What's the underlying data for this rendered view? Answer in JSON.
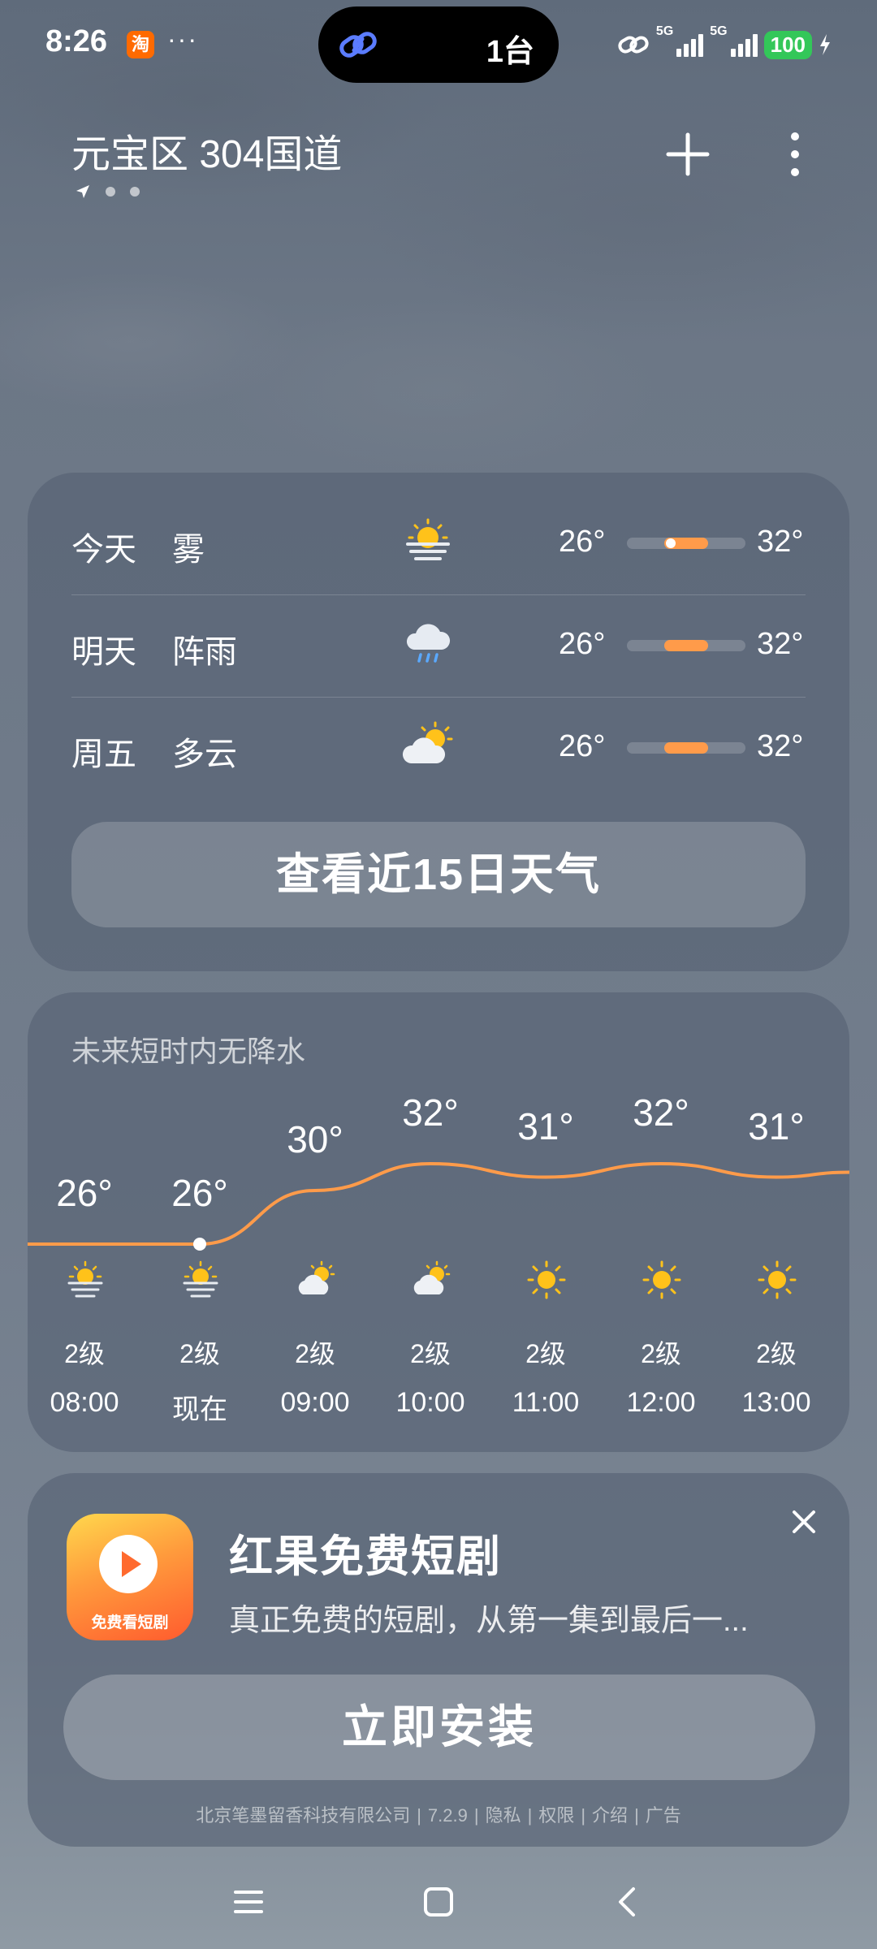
{
  "status_bar": {
    "time": "8:26",
    "app_badge": "淘",
    "more": "···",
    "island_count": "1台",
    "network_1": "5G",
    "network_2": "5G",
    "battery": "100"
  },
  "header": {
    "location": "元宝区 304国道",
    "icons": [
      "location-arrow-icon",
      "plus-icon",
      "more-vertical-icon"
    ]
  },
  "daily": [
    {
      "day": "今天",
      "condition": "雾",
      "icon": "fog-icon",
      "low": "26°",
      "high": "32°",
      "current_marker": true
    },
    {
      "day": "明天",
      "condition": "阵雨",
      "icon": "shower-icon",
      "low": "26°",
      "high": "32°",
      "current_marker": false
    },
    {
      "day": "周五",
      "condition": "多云",
      "icon": "partly-cloudy-icon",
      "low": "26°",
      "high": "32°",
      "current_marker": false
    }
  ],
  "daily_button": "查看近15日天气",
  "hourly": {
    "note": "未来短时内无降水",
    "items": [
      {
        "temp": "26°",
        "value": 26,
        "icon": "fog-icon",
        "wind": "2级",
        "time": "08:00"
      },
      {
        "temp": "26°",
        "value": 26,
        "icon": "fog-icon",
        "wind": "2级",
        "time": "现在"
      },
      {
        "temp": "30°",
        "value": 30,
        "icon": "partly-cloudy-icon",
        "wind": "2级",
        "time": "09:00"
      },
      {
        "temp": "32°",
        "value": 32,
        "icon": "partly-cloudy-icon",
        "wind": "2级",
        "time": "10:00"
      },
      {
        "temp": "31°",
        "value": 31,
        "icon": "sun-icon",
        "wind": "2级",
        "time": "11:00"
      },
      {
        "temp": "32°",
        "value": 32,
        "icon": "sun-icon",
        "wind": "2级",
        "time": "12:00"
      },
      {
        "temp": "31°",
        "value": 31,
        "icon": "sun-icon",
        "wind": "2级",
        "time": "13:00"
      }
    ]
  },
  "ad": {
    "icon_label": "免费看短剧",
    "title": "红果免费短剧",
    "description": "真正免费的短剧，从第一集到最后一...",
    "install": "立即安装",
    "footer": [
      "北京笔墨留香科技有限公司",
      "7.2.9",
      "隐私",
      "权限",
      "介绍",
      "广告"
    ]
  },
  "colors": {
    "accent": "#ff9b4a",
    "sun": "#ffc21a",
    "battery": "#33c759"
  }
}
